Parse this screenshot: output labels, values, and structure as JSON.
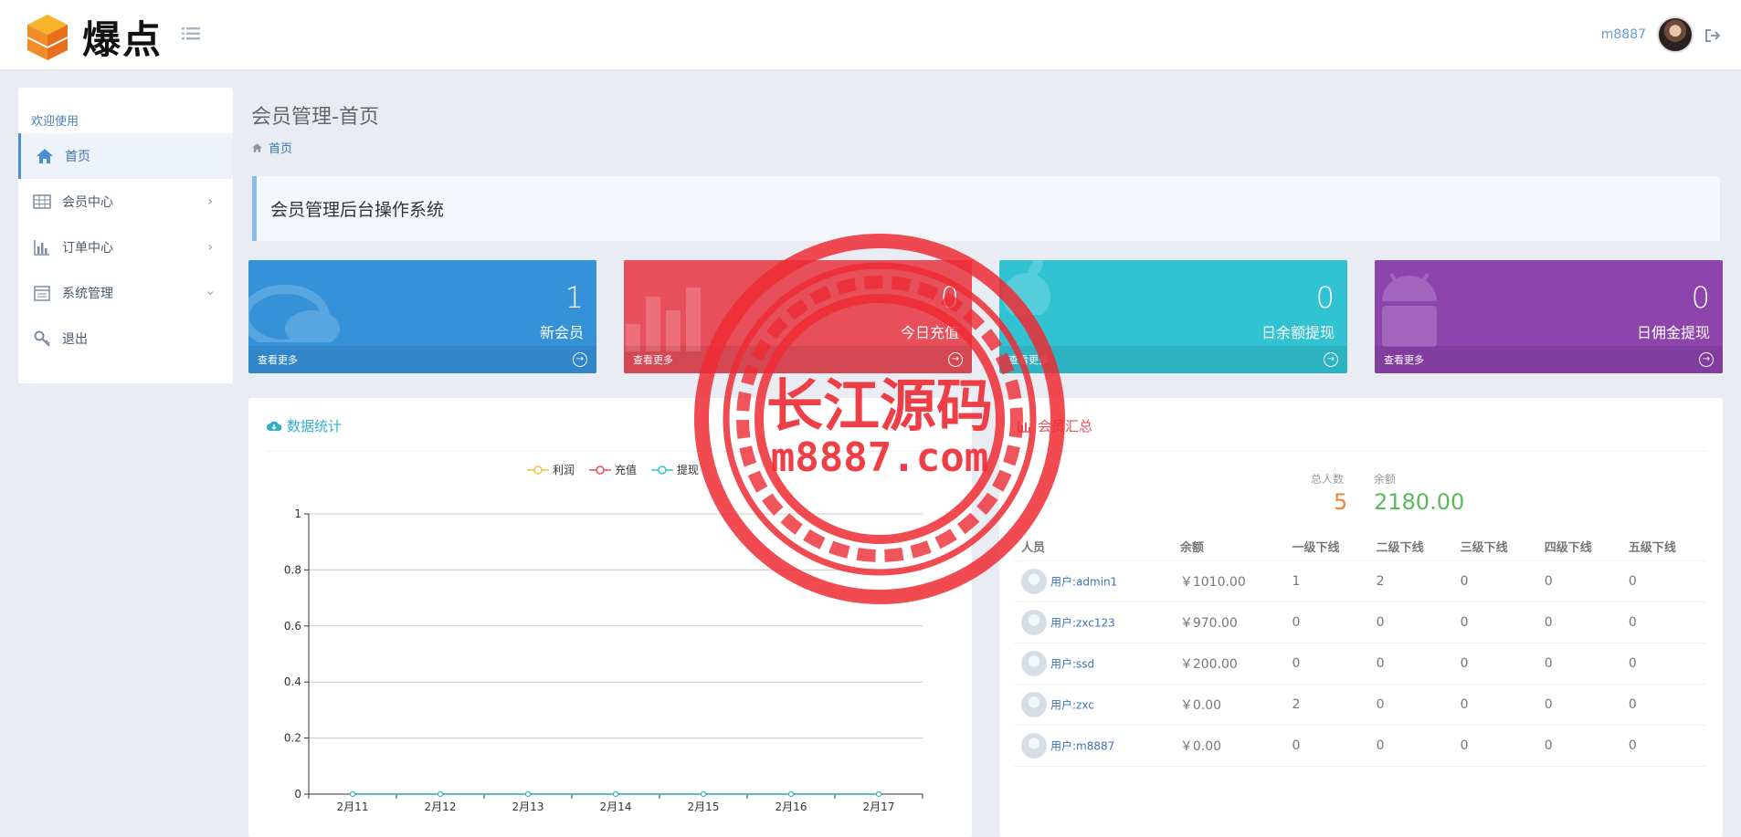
{
  "app": {
    "logo_text": "爆点"
  },
  "user": {
    "name": "m8887"
  },
  "sidebar": {
    "section": "欢迎使用",
    "items": [
      {
        "label": "首页"
      },
      {
        "label": "会员中心"
      },
      {
        "label": "订单中心"
      },
      {
        "label": "系统管理"
      },
      {
        "label": "退出"
      }
    ]
  },
  "page": {
    "title": "会员管理-首页",
    "breadcrumb": "首页",
    "welcome": "会员管理后台操作系统"
  },
  "cards": [
    {
      "value": "1",
      "label": "新会员",
      "more": "查看更多",
      "color": "#3592d9"
    },
    {
      "value": "0",
      "label": "今日充值",
      "more": "查看更多",
      "color": "#e74f5b"
    },
    {
      "value": "0",
      "label": "日余额提现",
      "more": "查看更多",
      "color": "#31c3d2"
    },
    {
      "value": "0",
      "label": "日佣金提现",
      "more": "查看更多",
      "color": "#8e44ad"
    }
  ],
  "stats_panel": {
    "title": "数据统计"
  },
  "chart_data": {
    "type": "line",
    "categories": [
      "2月11",
      "2月12",
      "2月13",
      "2月14",
      "2月15",
      "2月16",
      "2月17"
    ],
    "ylim": [
      0,
      1
    ],
    "yticks": [
      "0",
      "0.2",
      "0.4",
      "0.6",
      "0.8",
      "1"
    ],
    "series": [
      {
        "name": "利润",
        "color": "#f5c242",
        "values": [
          0,
          0,
          0,
          0,
          0,
          0,
          0
        ]
      },
      {
        "name": "充值",
        "color": "#e74f5b",
        "values": [
          0,
          0,
          0,
          0,
          0,
          0,
          0
        ]
      },
      {
        "name": "提现",
        "color": "#31c3d2",
        "values": [
          0,
          0,
          0,
          0,
          0,
          0,
          0
        ]
      }
    ]
  },
  "summary_panel": {
    "title": "会员汇总",
    "total_label": "总人数",
    "total_value": "5",
    "balance_label": "余额",
    "balance_value": "2180.00"
  },
  "table": {
    "headers": [
      "人员",
      "余额",
      "一级下线",
      "二级下线",
      "三级下线",
      "四级下线",
      "五级下线"
    ],
    "rows": [
      [
        "用户:admin1",
        "￥1010.00",
        "1",
        "2",
        "0",
        "0",
        "0"
      ],
      [
        "用户:zxc123",
        "￥970.00",
        "0",
        "0",
        "0",
        "0",
        "0"
      ],
      [
        "用户:ssd",
        "￥200.00",
        "0",
        "0",
        "0",
        "0",
        "0"
      ],
      [
        "用户:zxc",
        "￥0.00",
        "2",
        "0",
        "0",
        "0",
        "0"
      ],
      [
        "用户:m8887",
        "￥0.00",
        "0",
        "0",
        "0",
        "0",
        "0"
      ]
    ]
  },
  "watermark": {
    "line1": "长江源码",
    "line2": "m8887.com"
  }
}
